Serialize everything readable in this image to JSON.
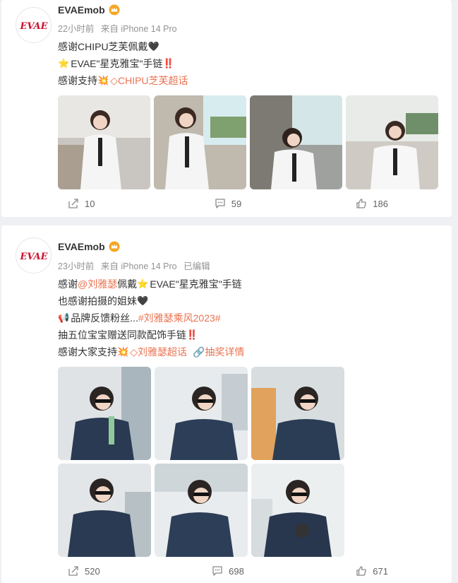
{
  "posts": [
    {
      "username": "EVAEmob",
      "avatar_text": "EVAE",
      "time": "22小时前",
      "source": "来自 iPhone 14 Pro",
      "edited": "",
      "lines": {
        "l1_text": "感谢CHIPU芝芙佩戴",
        "l2_text": "EVAE\"星克雅宝\"手链",
        "l3_prefix": "感谢支持",
        "l3_link": "CHIPU芝芙超话"
      },
      "stats": {
        "share": "10",
        "comment": "59",
        "like": "186"
      }
    },
    {
      "username": "EVAEmob",
      "avatar_text": "EVAE",
      "time": "23小时前",
      "source": "来自 iPhone 14 Pro",
      "edited": "已编辑",
      "lines": {
        "l1_prefix": "感谢",
        "l1_mention": "@刘雅瑟",
        "l1_mid": " 佩戴",
        "l1_suffix": "EVAE\"星克雅宝\"手链",
        "l2_text": "也感谢拍摄的姐妹",
        "l3_prefix": "品牌反馈粉丝...",
        "l3_tag": "#刘雅瑟乘风2023#",
        "l4_text": "抽五位宝宝赠送同款配饰手链",
        "l5_prefix": "感谢大家支持",
        "l5_link": "刘雅瑟超话",
        "l5_link2": "抽奖详情"
      },
      "stats": {
        "share": "520",
        "comment": "698",
        "like": "671"
      }
    }
  ],
  "colors": {
    "link": "#eb7350",
    "meta": "#939393",
    "bg": "#eef0f3"
  },
  "icons": [
    "vip-crown-icon",
    "black-heart-icon",
    "star-icon",
    "exclamation-icon",
    "burst-icon",
    "supertopic-icon",
    "megaphone-icon",
    "link-icon",
    "share-icon",
    "comment-icon",
    "like-icon"
  ]
}
